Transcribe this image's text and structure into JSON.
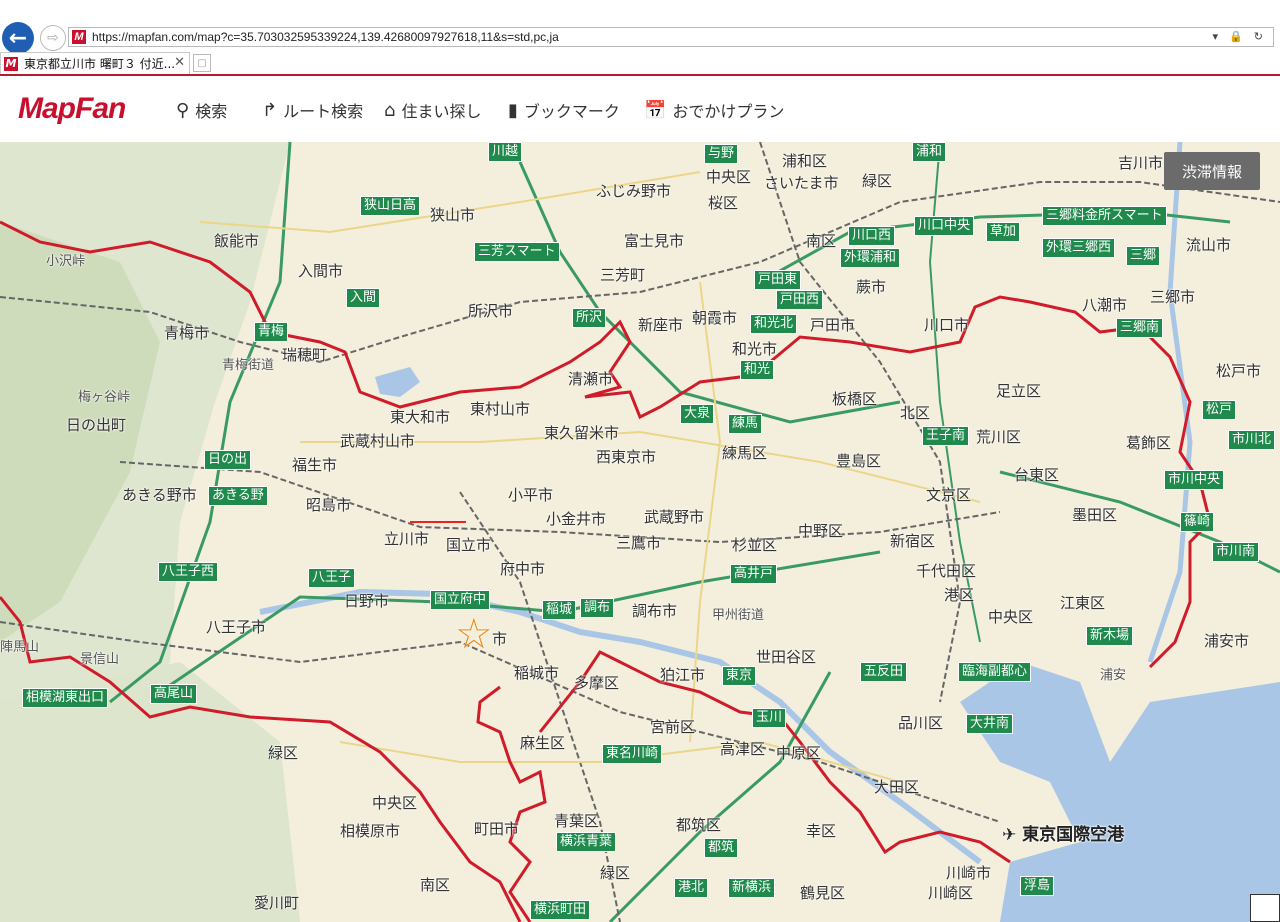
{
  "browser": {
    "url": "https://mapfan.com/map?c=35.703032595339224,139.42680097927618,11&s=std,pc,ja",
    "tab_title": "東京都立川市 曙町３ 付近...",
    "favicon_letter": "M"
  },
  "site": {
    "logo": "MapFan",
    "nav": [
      {
        "icon": "search-icon",
        "label": "検索"
      },
      {
        "icon": "route-icon",
        "label": "ルート検索"
      },
      {
        "icon": "house-search-icon",
        "label": "住まい探し"
      },
      {
        "icon": "bookmark-icon",
        "label": "ブックマーク"
      },
      {
        "icon": "calendar-icon",
        "label": "おでかけプラン"
      }
    ]
  },
  "map": {
    "traffic_button": "渋滞情報",
    "places": [
      {
        "t": "飯能市"
      },
      {
        "t": "入間市"
      },
      {
        "t": "狭山市"
      },
      {
        "t": "ふじみ野市"
      },
      {
        "t": "富士見市"
      },
      {
        "t": "三芳町"
      },
      {
        "t": "所沢市"
      },
      {
        "t": "新座市"
      },
      {
        "t": "朝霞市"
      },
      {
        "t": "和光市"
      },
      {
        "t": "戸田市"
      },
      {
        "t": "蕨市"
      },
      {
        "t": "川口市"
      },
      {
        "t": "八潮市"
      },
      {
        "t": "三郷市"
      },
      {
        "t": "流山市"
      },
      {
        "t": "吉川市"
      },
      {
        "t": "浦和区"
      },
      {
        "t": "中央区"
      },
      {
        "t": "さいたま市"
      },
      {
        "t": "緑区"
      },
      {
        "t": "桜区"
      },
      {
        "t": "南区"
      },
      {
        "t": "青梅市"
      },
      {
        "t": "瑞穂町"
      },
      {
        "t": "清瀬市"
      },
      {
        "t": "東大和市"
      },
      {
        "t": "東村山市"
      },
      {
        "t": "東久留米市"
      },
      {
        "t": "板橋区"
      },
      {
        "t": "北区"
      },
      {
        "t": "足立区"
      },
      {
        "t": "松戸市"
      },
      {
        "t": "日の出町"
      },
      {
        "t": "武蔵村山市"
      },
      {
        "t": "西東京市"
      },
      {
        "t": "練馬区"
      },
      {
        "t": "豊島区"
      },
      {
        "t": "荒川区"
      },
      {
        "t": "葛飾区"
      },
      {
        "t": "台東区"
      },
      {
        "t": "福生市"
      },
      {
        "t": "あきる野市"
      },
      {
        "t": "昭島市"
      },
      {
        "t": "小平市"
      },
      {
        "t": "文京区"
      },
      {
        "t": "墨田区"
      },
      {
        "t": "小金井市"
      },
      {
        "t": "武蔵野市"
      },
      {
        "t": "立川市"
      },
      {
        "t": "国立市"
      },
      {
        "t": "三鷹市"
      },
      {
        "t": "杉並区"
      },
      {
        "t": "中野区"
      },
      {
        "t": "新宿区"
      },
      {
        "t": "千代田区"
      },
      {
        "t": "江東区"
      },
      {
        "t": "府中市"
      },
      {
        "t": "日野市"
      },
      {
        "t": "港区"
      },
      {
        "t": "中央区"
      },
      {
        "t": "八王子市"
      },
      {
        "t": "調布市"
      },
      {
        "t": "甲州街道"
      },
      {
        "t": "浦安市"
      },
      {
        "t": "市"
      },
      {
        "t": "稲城市"
      },
      {
        "t": "狛江市"
      },
      {
        "t": "世田谷区"
      },
      {
        "t": "多摩区"
      },
      {
        "t": "浦安"
      },
      {
        "t": "品川区"
      },
      {
        "t": "宮前区"
      },
      {
        "t": "緑区"
      },
      {
        "t": "麻生区"
      },
      {
        "t": "高津区"
      },
      {
        "t": "中原区"
      },
      {
        "t": "大田区"
      },
      {
        "t": "中央区"
      },
      {
        "t": "青葉区"
      },
      {
        "t": "相模原市"
      },
      {
        "t": "町田市"
      },
      {
        "t": "都筑区"
      },
      {
        "t": "幸区"
      },
      {
        "t": "東京国際空港"
      },
      {
        "t": "緑区"
      },
      {
        "t": "川崎市"
      },
      {
        "t": "川崎区"
      },
      {
        "t": "愛川町"
      },
      {
        "t": "南区"
      },
      {
        "t": "鶴見区"
      },
      {
        "t": "日の出町"
      },
      {
        "t": "梅ヶ谷峠"
      },
      {
        "t": "小沢峠"
      },
      {
        "t": "陣馬山"
      },
      {
        "t": "景信山"
      },
      {
        "t": "青梅街道"
      }
    ],
    "interchanges": [
      {
        "t": "川越"
      },
      {
        "t": "与野"
      },
      {
        "t": "浦和"
      },
      {
        "t": "狭山日高"
      },
      {
        "t": "三芳スマート"
      },
      {
        "t": "入間"
      },
      {
        "t": "青梅"
      },
      {
        "t": "所沢"
      },
      {
        "t": "戸田東"
      },
      {
        "t": "戸田西"
      },
      {
        "t": "和光北"
      },
      {
        "t": "和光"
      },
      {
        "t": "川口西"
      },
      {
        "t": "外環浦和"
      },
      {
        "t": "川口中央"
      },
      {
        "t": "草加"
      },
      {
        "t": "三郷料金所スマート"
      },
      {
        "t": "外環三郷西"
      },
      {
        "t": "三郷"
      },
      {
        "t": "三郷南"
      },
      {
        "t": "大泉"
      },
      {
        "t": "練馬"
      },
      {
        "t": "王子南"
      },
      {
        "t": "松戸"
      },
      {
        "t": "市川北"
      },
      {
        "t": "日の出"
      },
      {
        "t": "あきる野"
      },
      {
        "t": "市川中央"
      },
      {
        "t": "篠崎"
      },
      {
        "t": "八王子西"
      },
      {
        "t": "八王子"
      },
      {
        "t": "国立府中"
      },
      {
        "t": "稲城"
      },
      {
        "t": "調布"
      },
      {
        "t": "高井戸"
      },
      {
        "t": "市川南"
      },
      {
        "t": "新木場"
      },
      {
        "t": "相模湖東出口"
      },
      {
        "t": "高尾山"
      },
      {
        "t": "五反田"
      },
      {
        "t": "臨海副都心"
      },
      {
        "t": "東京"
      },
      {
        "t": "玉川"
      },
      {
        "t": "大井南"
      },
      {
        "t": "東名川崎"
      },
      {
        "t": "横浜青葉"
      },
      {
        "t": "都筑"
      },
      {
        "t": "港北"
      },
      {
        "t": "新横浜"
      },
      {
        "t": "浮島"
      },
      {
        "t": "横浜町田"
      }
    ]
  }
}
